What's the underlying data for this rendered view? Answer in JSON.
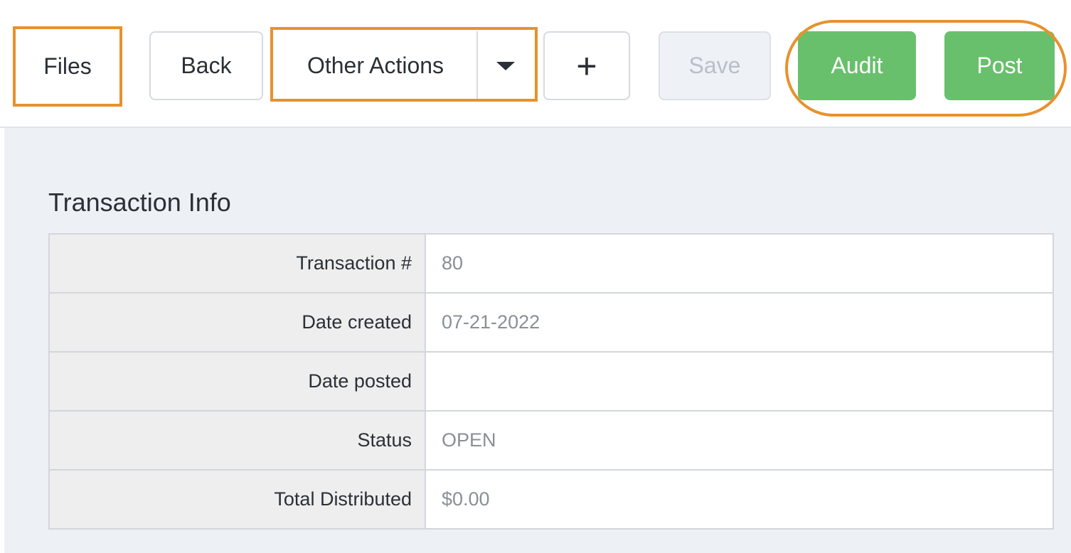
{
  "toolbar": {
    "files_label": "Files",
    "back_label": "Back",
    "other_actions_label": "Other Actions",
    "plus_label": "+",
    "save_label": "Save",
    "audit_label": "Audit",
    "post_label": "Post",
    "icons": [
      "caret-down-icon"
    ],
    "colors": {
      "highlight": "#e8912d",
      "primary_green": "#68c06c",
      "disabled_bg": "#eef1f5"
    }
  },
  "section": {
    "title": "Transaction Info"
  },
  "info_rows": [
    {
      "label": "Transaction #",
      "value": "80"
    },
    {
      "label": "Date created",
      "value": "07-21-2022"
    },
    {
      "label": "Date posted",
      "value": ""
    },
    {
      "label": "Status",
      "value": "OPEN"
    },
    {
      "label": "Total Distributed",
      "value": "$0.00"
    }
  ]
}
